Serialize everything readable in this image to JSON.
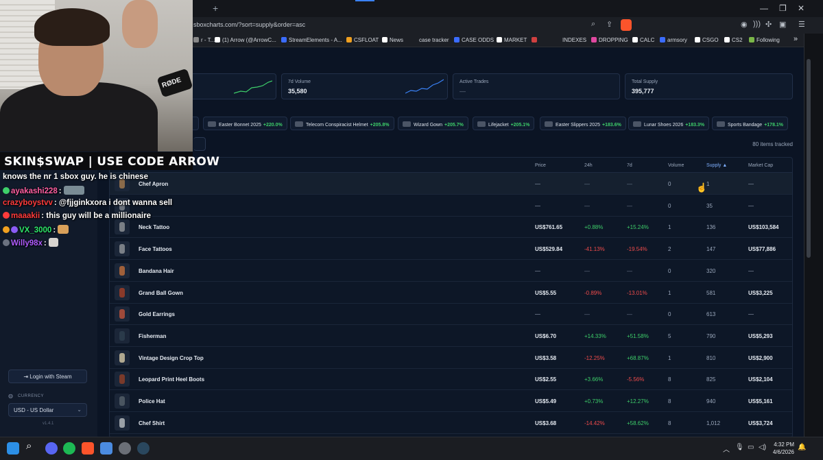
{
  "browser": {
    "url": "sboxcharts.com/?sort=supply&order=asc",
    "new_tab_label": "+",
    "bookmarks": [
      {
        "label": "r - T...",
        "color": "#888888"
      },
      {
        "label": "(1) Arrow (@ArrowC...",
        "color": "#ffffff"
      },
      {
        "label": "StreamElements - A...",
        "color": "#3b6cff"
      },
      {
        "label": "CSFLOAT",
        "color": "#f0a020"
      },
      {
        "label": "News",
        "color": "#ffffff"
      },
      {
        "label": "case tracker",
        "color": "#1c1f25"
      },
      {
        "label": "CASE ODDS",
        "color": "#3b6cff"
      },
      {
        "label": "MARKET",
        "color": "#ffffff"
      },
      {
        "label": "",
        "color": "#d04040"
      },
      {
        "label": "INDEXES",
        "color": "#1c1f25"
      },
      {
        "label": "DROPPING",
        "color": "#e048a0"
      },
      {
        "label": "CALC",
        "color": "#ffffff"
      },
      {
        "label": "armsory",
        "color": "#3b6cff"
      },
      {
        "label": "CSGO",
        "color": "#ffffff"
      },
      {
        "label": "CS2",
        "color": "#ffffff"
      },
      {
        "label": "Following",
        "color": "#7ab648"
      }
    ],
    "more_bookmarks": "»"
  },
  "stats": [
    {
      "label": "",
      "value": ""
    },
    {
      "label": "7d Volume",
      "value": "35,580"
    },
    {
      "label": "Active Trades",
      "value": "—"
    },
    {
      "label": "Total Supply",
      "value": "395,777"
    }
  ],
  "trending": [
    {
      "name": "",
      "change": "%"
    },
    {
      "name": "Easter Bonnet 2025",
      "change": "+220.0%"
    },
    {
      "name": "Telecom Conspiracist Helmet",
      "change": "+205.8%"
    },
    {
      "name": "Wizard Gown",
      "change": "+205.7%"
    },
    {
      "name": "Lifejacket",
      "change": "+205.1%"
    },
    {
      "name": "Easter Slippers 2025",
      "change": "+183.6%"
    },
    {
      "name": "Lunar Shoes 2026",
      "change": "+183.3%"
    },
    {
      "name": "Sports Bandage",
      "change": "+178.1%"
    }
  ],
  "items_tracked": "80 items tracked",
  "table": {
    "headers": {
      "price": "Price",
      "h24": "24h",
      "d7": "7d",
      "volume": "Volume",
      "supply": "Supply ▲",
      "market_cap": "Market Cap"
    },
    "rows": [
      {
        "name": "Chef Apron",
        "price": "—",
        "h24": "—",
        "d7": "—",
        "volume": "0",
        "supply": "1",
        "cap": "—"
      },
      {
        "name": "",
        "price": "—",
        "h24": "—",
        "d7": "—",
        "volume": "0",
        "supply": "35",
        "cap": "—"
      },
      {
        "name": "Neck Tattoo",
        "price": "US$761.65",
        "h24": "+0.88%",
        "d7": "+15.24%",
        "volume": "1",
        "supply": "136",
        "cap": "US$103,584"
      },
      {
        "name": "Face Tattoos",
        "price": "US$529.84",
        "h24": "-41.13%",
        "d7": "-19.54%",
        "volume": "2",
        "supply": "147",
        "cap": "US$77,886"
      },
      {
        "name": "Bandana Hair",
        "price": "—",
        "h24": "—",
        "d7": "—",
        "volume": "0",
        "supply": "320",
        "cap": "—"
      },
      {
        "name": "Grand Ball Gown",
        "price": "US$5.55",
        "h24": "-0.89%",
        "d7": "-13.01%",
        "volume": "1",
        "supply": "581",
        "cap": "US$3,225"
      },
      {
        "name": "Gold Earrings",
        "price": "—",
        "h24": "—",
        "d7": "—",
        "volume": "0",
        "supply": "613",
        "cap": "—"
      },
      {
        "name": "Fisherman",
        "price": "US$6.70",
        "h24": "+14.33%",
        "d7": "+51.58%",
        "volume": "5",
        "supply": "790",
        "cap": "US$5,293"
      },
      {
        "name": "Vintage Design Crop Top",
        "price": "US$3.58",
        "h24": "-12.25%",
        "d7": "+68.87%",
        "volume": "1",
        "supply": "810",
        "cap": "US$2,900"
      },
      {
        "name": "Leopard Print Heel Boots",
        "price": "US$2.55",
        "h24": "+3.66%",
        "d7": "-5.56%",
        "volume": "8",
        "supply": "825",
        "cap": "US$2,104"
      },
      {
        "name": "Police Hat",
        "price": "US$5.49",
        "h24": "+0.73%",
        "d7": "+12.27%",
        "volume": "8",
        "supply": "940",
        "cap": "US$5,161"
      },
      {
        "name": "Chef Shirt",
        "price": "US$3.68",
        "h24": "-14.42%",
        "d7": "+58.62%",
        "volume": "8",
        "supply": "1,012",
        "cap": "US$3,724"
      }
    ]
  },
  "sidebar": {
    "login_label": "Login with Steam",
    "currency_label": "CURRENCY",
    "currency_value": "USD - US Dollar",
    "version": "v1.4.1"
  },
  "overlay": {
    "banner": "SKIN$SWAP | USE CODE ARROW",
    "chat": [
      {
        "user": "",
        "text": "knows the nr 1 sbox guy. he is chinese",
        "color": "#ffffff"
      },
      {
        "user": "ayakashi228",
        "text": "",
        "color": "#ff5fa2",
        "emote": true
      },
      {
        "user": "crazyboystvv",
        "text": "@fjjginkxora i dont wanna sell",
        "color": "#ff3b3b"
      },
      {
        "user": "maaakii",
        "text": "this guy will be a millionaire",
        "color": "#ff3b3b"
      },
      {
        "user": "VX_3000",
        "text": "",
        "color": "#2ee86b",
        "emote": true
      },
      {
        "user": "Willy98x",
        "text": "",
        "color": "#b05cff",
        "emote": true
      }
    ]
  },
  "taskbar": {
    "time": "4:32 PM",
    "date": "4/6/2026"
  }
}
